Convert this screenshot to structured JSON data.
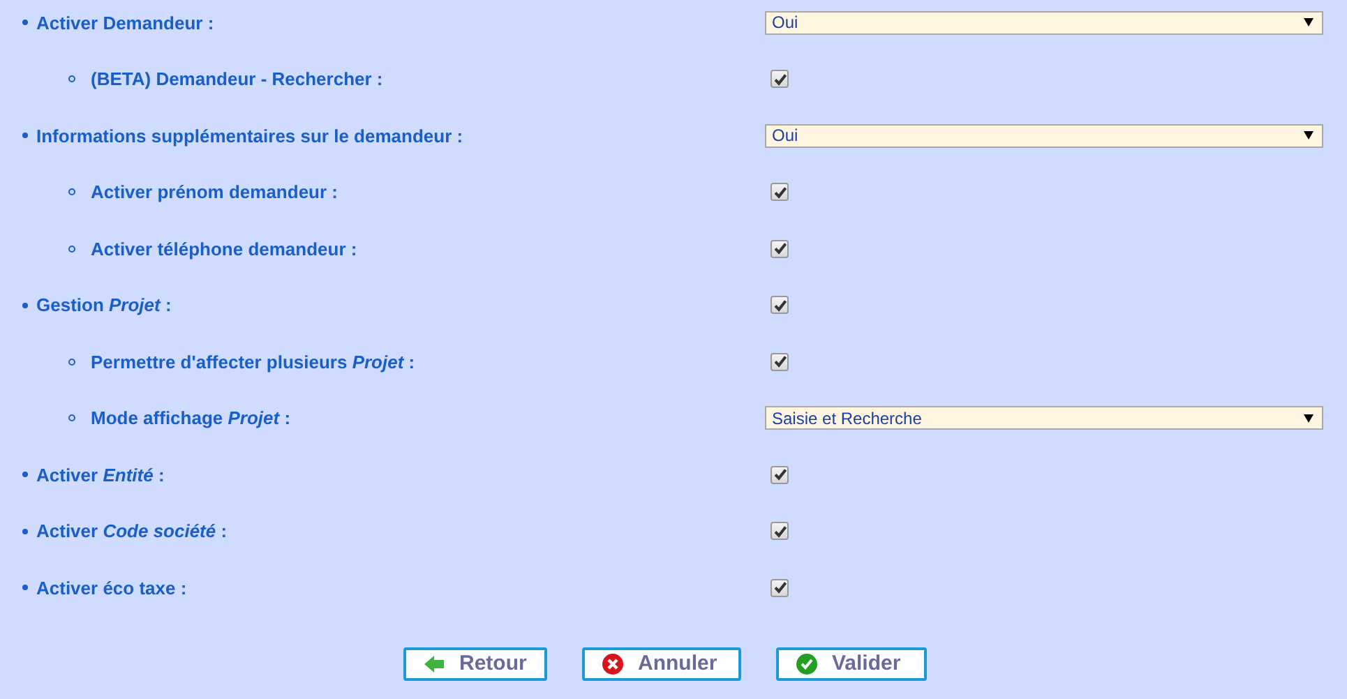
{
  "settings": [
    {
      "label": "Activer Demandeur :",
      "kind": "select",
      "value": "Oui",
      "children": [
        {
          "label": "(BETA) Demandeur - Rechercher :",
          "kind": "checkbox",
          "checked": true
        }
      ]
    },
    {
      "label": "Informations supplémentaires sur le demandeur :",
      "kind": "select",
      "value": "Oui",
      "children": [
        {
          "label": "Activer prénom demandeur :",
          "kind": "checkbox",
          "checked": true
        },
        {
          "label": "Activer téléphone demandeur :",
          "kind": "checkbox",
          "checked": true
        }
      ]
    },
    {
      "label": "Gestion *Projet* :",
      "kind": "checkbox",
      "checked": true,
      "children": [
        {
          "label": "Permettre d'affecter plusieurs *Projet* :",
          "kind": "checkbox",
          "checked": true
        },
        {
          "label": "Mode affichage *Projet* :",
          "kind": "select",
          "value": "Saisie et Recherche"
        }
      ]
    },
    {
      "label": "Activer *Entité* :",
      "kind": "checkbox",
      "checked": true
    },
    {
      "label": "Activer *Code société* :",
      "kind": "checkbox",
      "checked": true
    },
    {
      "label": "Activer éco taxe :",
      "kind": "checkbox",
      "checked": true
    }
  ],
  "buttons": [
    {
      "label": "Retour",
      "kind": "back"
    },
    {
      "label": "Annuler",
      "kind": "cancel"
    },
    {
      "label": "Valider",
      "kind": "ok"
    }
  ]
}
